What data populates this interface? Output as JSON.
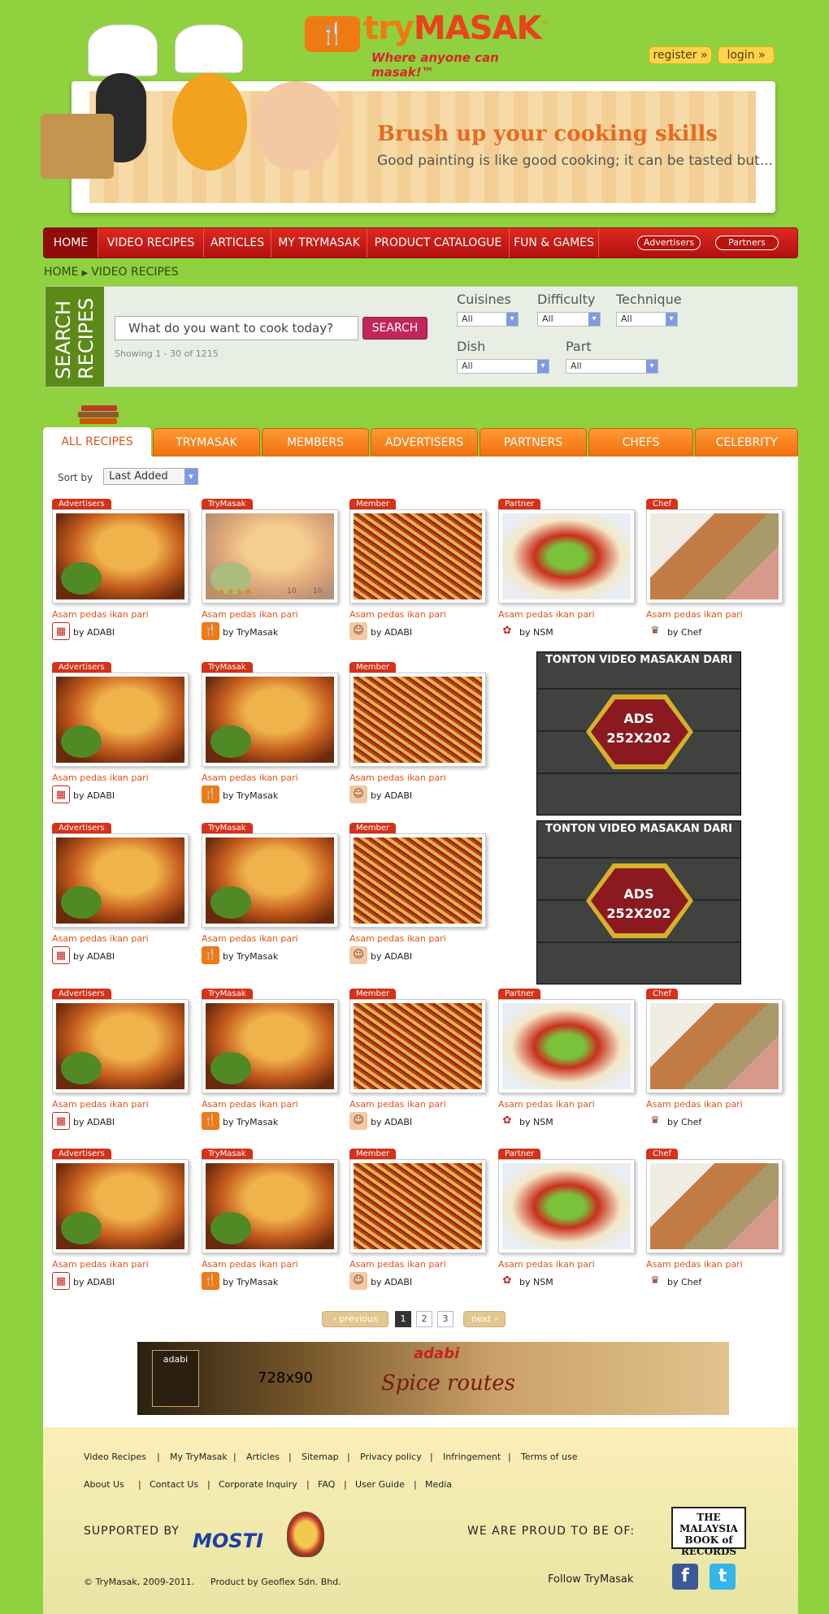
{
  "header": {
    "logo_icon": "🍴",
    "logo_try": "try",
    "logo_masak": "MASAK",
    "logo_tm": "™",
    "tagline": "Where anyone can masak!™",
    "register_label": "register »",
    "login_label": "login »"
  },
  "banner": {
    "title": "Brush up your cooking skills",
    "subtitle": "Good painting is like good cooking; it can be tasted but..."
  },
  "nav": {
    "items": [
      "HOME",
      "VIDEO RECIPES",
      "ARTICLES",
      "MY TRYMASAK",
      "PRODUCT CATALOGUE",
      "FUN & GAMES"
    ],
    "active": "HOME",
    "pills": [
      "Advertisers",
      "Partners"
    ]
  },
  "breadcrumb": {
    "home": "HOME",
    "sep": "▶",
    "current": "VIDEO RECIPES"
  },
  "search": {
    "side_label": "SEARCH RECIPES",
    "side_word1": "SEARCH",
    "side_word2": "RECIPES",
    "placeholder": "What do you want to cook today?",
    "button": "SEARCH",
    "showing": "Showing 1 - 30 of 1215",
    "filters": {
      "cuisines": {
        "label": "Cuisines",
        "value": "All"
      },
      "difficulty": {
        "label": "Difficulty",
        "value": "All"
      },
      "technique": {
        "label": "Technique",
        "value": "All"
      },
      "dish": {
        "label": "Dish",
        "value": "All"
      },
      "part": {
        "label": "Part",
        "value": "All"
      }
    }
  },
  "tabs": [
    "ALL RECIPES",
    "TRYMASAK",
    "MEMBERS",
    "ADVERTISERS",
    "PARTNERS",
    "CHEFS",
    "CELEBRITY"
  ],
  "sort": {
    "label": "Sort by",
    "value": "Last Added"
  },
  "recipe_title": "Asam pedas ikan pari",
  "card_types": {
    "advertisers": {
      "tag": "Advertisers",
      "author": "by ADABI"
    },
    "trymasak": {
      "tag": "TryMasak",
      "author": "by TryMasak"
    },
    "member": {
      "tag": "Member",
      "author": "by ADABI"
    },
    "partner": {
      "tag": "Partner",
      "author": "by NSM"
    },
    "chef": {
      "tag": "Chef",
      "author": "by Chef"
    }
  },
  "hover_card": {
    "rating": "★★★★★",
    "views": "10",
    "comments": "10"
  },
  "ads": {
    "box_top": "TONTON VIDEO MASAKAN DARI",
    "box_label1": "ADS",
    "box_label2": "252X202",
    "leader_size": "728x90",
    "leader_brand": "adabi",
    "leader_tag": "Spice routes",
    "leader_logo": "adabi"
  },
  "pager": {
    "prev": "‹ previous",
    "pages": [
      "1",
      "2",
      "3"
    ],
    "current": "1",
    "next": "next ›"
  },
  "footer": {
    "links_row1": [
      "Video Recipes",
      "My TryMasak",
      "Articles",
      "Sitemap",
      "Privacy policy",
      "Infringement",
      "Terms of use"
    ],
    "links_row2": [
      "About Us",
      "Contact Us",
      "Corporate Inquiry",
      "FAQ",
      "User Guide",
      "Media"
    ],
    "supported_by": "SUPPORTED BY",
    "mosti": "MOSTI",
    "proud": "WE ARE PROUD TO BE OF:",
    "records": "THE MALAYSIA BOOK of RECORDS",
    "copyright": "© TryMasak, 2009-2011.",
    "product": "Product by Geoflex Sdn. Bhd.",
    "follow": "Follow TryMasak",
    "facebook": "f",
    "twitter": "t"
  },
  "colors": {
    "page_bg": "#8fd13f",
    "nav_red": "#c81a14",
    "tab_orange": "#f47a1c",
    "title_orange": "#e0531a"
  }
}
